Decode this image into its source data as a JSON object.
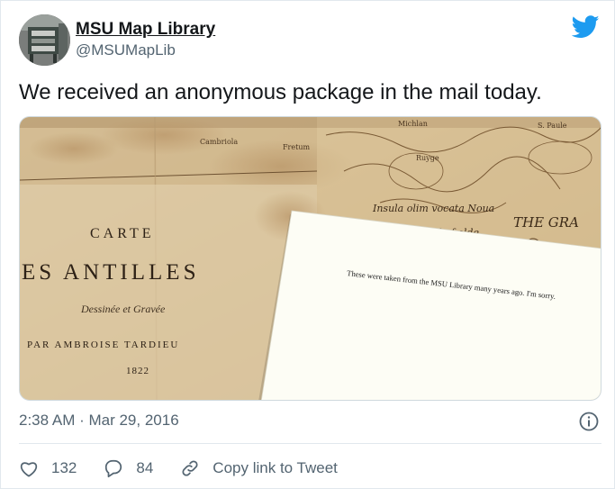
{
  "user": {
    "name": "MSU Map Library",
    "handle": "@MSUMapLib"
  },
  "tweet": {
    "text": "We received an anonymous package in the mail today.",
    "timestamp": "2:38 AM · Mar 29, 2016"
  },
  "media": {
    "map_title": "CARTE",
    "map_subtitle": "ES ANTILLES",
    "map_engraved": "Dessinée et Gravée",
    "map_author": "PAR AMBROISE TARDIEU",
    "map_year": "1822",
    "map_label_a": "Insula olim vocata Noua",
    "map_label_b": "Castell of olde",
    "map_label_c": "THE GRA",
    "map_label_d": "Cambriola",
    "map_label_e": "Fretum",
    "map_label_f": "Ruyge",
    "map_label_g": "Michlan",
    "map_label_h": "S. Paule",
    "note_text": "These were taken from the MSU Library many years ago.  I'm sorry."
  },
  "actions": {
    "likes": "132",
    "replies": "84",
    "copy_link": "Copy link to Tweet"
  },
  "colors": {
    "twitter_blue": "#1d9bf0",
    "secondary_text": "#536471",
    "map_paper": "#d9c4a0",
    "note_paper": "#fdfdf5"
  },
  "icons": {
    "logo": "twitter-bird-icon",
    "info": "info-icon",
    "like": "heart-icon",
    "reply": "reply-bubble-icon",
    "link": "link-icon"
  }
}
